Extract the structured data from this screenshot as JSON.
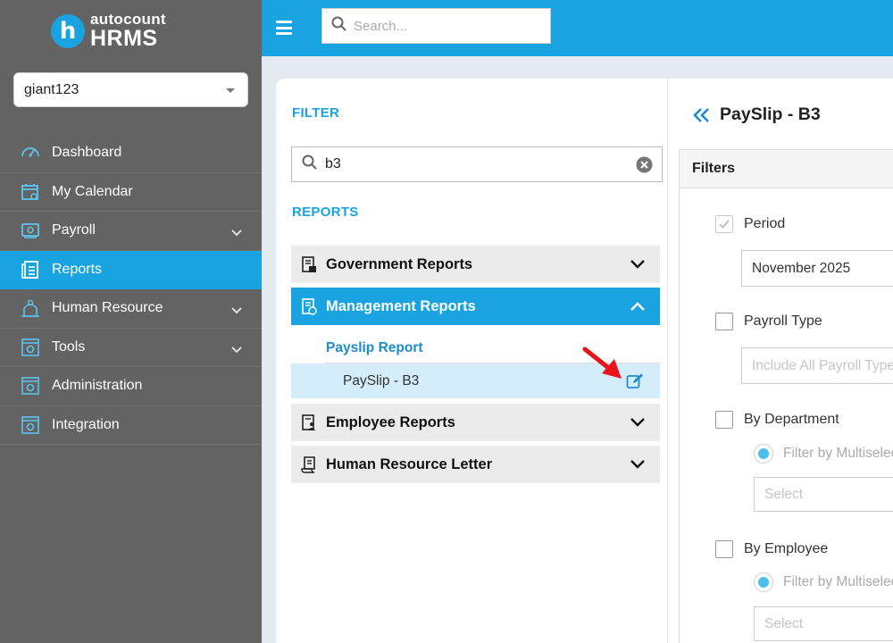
{
  "brand": {
    "top": "autocount",
    "bottom": "HRMS",
    "mark": "h"
  },
  "company": {
    "value": "giant123"
  },
  "nav": [
    {
      "label": "Dashboard",
      "icon": "dashboard-icon"
    },
    {
      "label": "My Calendar",
      "icon": "calendar-icon"
    },
    {
      "label": "Payroll",
      "icon": "payroll-icon",
      "expandable": true
    },
    {
      "label": "Reports",
      "icon": "reports-icon",
      "active": true
    },
    {
      "label": "Human Resource",
      "icon": "human-resource-icon",
      "expandable": true
    },
    {
      "label": "Tools",
      "icon": "tools-icon",
      "expandable": true
    },
    {
      "label": "Administration",
      "icon": "administration-icon"
    },
    {
      "label": "Integration",
      "icon": "integration-icon"
    }
  ],
  "topbar": {
    "search_placeholder": "Search..."
  },
  "filter_panel": {
    "filter_title": "FILTER",
    "search_value": "b3",
    "reports_title": "REPORTS",
    "groups": [
      {
        "label": "Government Reports",
        "expanded": false
      },
      {
        "label": "Management Reports",
        "expanded": true
      },
      {
        "label": "Employee Reports",
        "expanded": false
      },
      {
        "label": "Human Resource Letter",
        "expanded": false
      }
    ],
    "sub_category": "Payslip Report",
    "sub_item": "PaySlip - B3"
  },
  "report": {
    "title": "PaySlip - B3",
    "filters_heading": "Filters",
    "period_label": "Period",
    "period_checked": true,
    "period_value": "November 2025",
    "payroll_type_label": "Payroll Type",
    "payroll_type_placeholder": "Include All Payroll Type",
    "by_department_label": "By Department",
    "department_radio_label": "Filter by Multiselect",
    "department_select_placeholder": "Select",
    "by_employee_label": "By Employee",
    "employee_radio_label": "Filter by Multiselect",
    "employee_select_placeholder": "Select"
  },
  "colors": {
    "accent": "#19a3e0",
    "sidebar": "#636363",
    "highlight": "#d3eefa",
    "arrow": "#e8141b"
  }
}
